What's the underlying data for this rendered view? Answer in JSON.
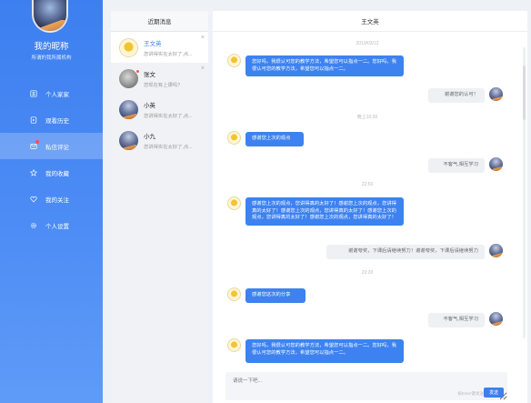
{
  "profile": {
    "nickname": "我的昵称",
    "bio": "所谓的我所属机构"
  },
  "colors": {
    "accent": "#3d7ff0",
    "unread": "#ff4d4f"
  },
  "menu": [
    {
      "label": "个人家家",
      "icon": "profile-icon",
      "active": false
    },
    {
      "label": "观看历史",
      "icon": "history-icon",
      "active": false
    },
    {
      "label": "私信评论",
      "icon": "message-icon",
      "active": true,
      "badge": true
    },
    {
      "label": "我的收藏",
      "icon": "star-icon",
      "active": false
    },
    {
      "label": "我的关注",
      "icon": "heart-icon",
      "active": false
    },
    {
      "label": "个人设置",
      "icon": "gear-icon",
      "active": false
    }
  ],
  "conversations": {
    "header": "近期消息",
    "items": [
      {
        "name": "王文英",
        "preview": "您讲得实在太好了,点...",
        "avatar": "sun",
        "active": true,
        "closable": true
      },
      {
        "name": "张文",
        "preview": "您现在有上课吗?",
        "avatar": "gray",
        "active": false,
        "closable": true,
        "unread": true
      },
      {
        "name": "小英",
        "preview": "您讲得实在太好了,点...",
        "avatar": "moon",
        "active": false,
        "closable": false
      },
      {
        "name": "小九",
        "preview": "您讲得实在太好了,点...",
        "avatar": "moon",
        "active": false,
        "closable": false
      }
    ]
  },
  "chat": {
    "title": "王文英",
    "messages": [
      {
        "type": "time",
        "text": "2019/03/12"
      },
      {
        "type": "in",
        "text": "您好吗，我很认可您的教学方法，希望您可以指点一二。您好吗，我很认可您的教学方法，希望您可以指点一二。"
      },
      {
        "type": "out",
        "text": "谢谢您的认可！"
      },
      {
        "type": "time",
        "text": "晚上10:30"
      },
      {
        "type": "in",
        "text": "感谢您上次的观点"
      },
      {
        "type": "out",
        "text": "不客气,相互学习"
      },
      {
        "type": "time",
        "text": "22:50"
      },
      {
        "type": "in",
        "text": "感谢您上次的观点，您讲得真的太好了！感谢您上次的观点，您讲得真的太好了！感谢您上次的观点，您讲得真的太好了！感谢您上次的观点，您讲得真的太好了！感谢您上次的观点，您讲得真的太好了！"
      },
      {
        "type": "out",
        "text": "谢谢夸奖，下课后请继续努力！谢谢夸奖，下课后请继续努力"
      },
      {
        "type": "time",
        "text": "23:20"
      },
      {
        "type": "in",
        "text": "感谢您这次的分享"
      },
      {
        "type": "out",
        "text": "不客气,相互学习"
      },
      {
        "type": "in",
        "text": "您好吗，我很认可您的教学方法，希望您可以指点一二。您好吗，我很认可您的教学方法，希望您可以指点一二。"
      }
    ],
    "input": {
      "placeholder": "请说一下吧...",
      "hint": "按Enter键发送",
      "send_label": "发送"
    }
  }
}
